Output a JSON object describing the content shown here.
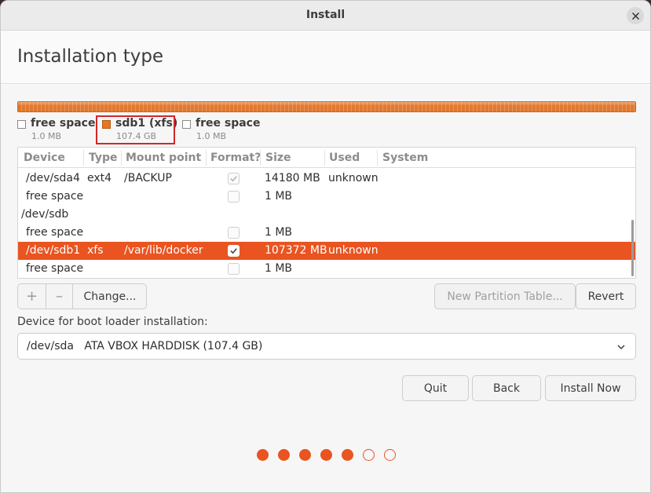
{
  "window": {
    "title": "Install"
  },
  "page": {
    "title": "Installation type"
  },
  "legend": [
    {
      "name": "free space",
      "size": "1.0 MB",
      "color": "#ffffff"
    },
    {
      "name": "sdb1 (xfs)",
      "size": "107.4 GB",
      "color": "#e9761f"
    },
    {
      "name": "free space",
      "size": "1.0 MB",
      "color": "#ffffff"
    }
  ],
  "table": {
    "columns": [
      "Device",
      "Type",
      "Mount point",
      "Format?",
      "Size",
      "Used",
      "System"
    ],
    "rows": [
      {
        "device": "/dev/sda4",
        "type": "ext4",
        "mount": "/BACKUP",
        "format": true,
        "format_enabled": false,
        "size": "14180 MB",
        "used": "unknown",
        "system": ""
      },
      {
        "device": "free space",
        "type": "",
        "mount": "",
        "format": false,
        "format_enabled": false,
        "size": "1 MB",
        "used": "",
        "system": ""
      },
      {
        "device": "/dev/sdb",
        "type": "",
        "mount": "",
        "format": null,
        "size": "",
        "used": "",
        "system": ""
      },
      {
        "device": "free space",
        "type": "",
        "mount": "",
        "format": false,
        "format_enabled": false,
        "size": "1 MB",
        "used": "",
        "system": ""
      },
      {
        "device": "/dev/sdb1",
        "type": "xfs",
        "mount": "/var/lib/docker",
        "format": true,
        "format_enabled": true,
        "size": "107372 MB",
        "used": "unknown",
        "system": "",
        "selected": true
      },
      {
        "device": "free space",
        "type": "",
        "mount": "",
        "format": false,
        "format_enabled": false,
        "size": "1 MB",
        "used": "",
        "system": ""
      }
    ]
  },
  "toolbar": {
    "add_icon": "plus-icon",
    "add_label": "+",
    "remove_icon": "minus-icon",
    "remove_label": "–",
    "change_label": "Change...",
    "new_table_label": "New Partition Table...",
    "revert_label": "Revert"
  },
  "bootloader": {
    "label": "Device for boot loader installation:",
    "value": "/dev/sda   ATA VBOX HARDDISK (107.4 GB)"
  },
  "actions": {
    "quit": "Quit",
    "back": "Back",
    "install": "Install Now"
  },
  "progress": {
    "total_steps": 7,
    "completed_steps": 5
  },
  "colors": {
    "accent": "#e95420",
    "partition_bar": "#e2782d"
  }
}
